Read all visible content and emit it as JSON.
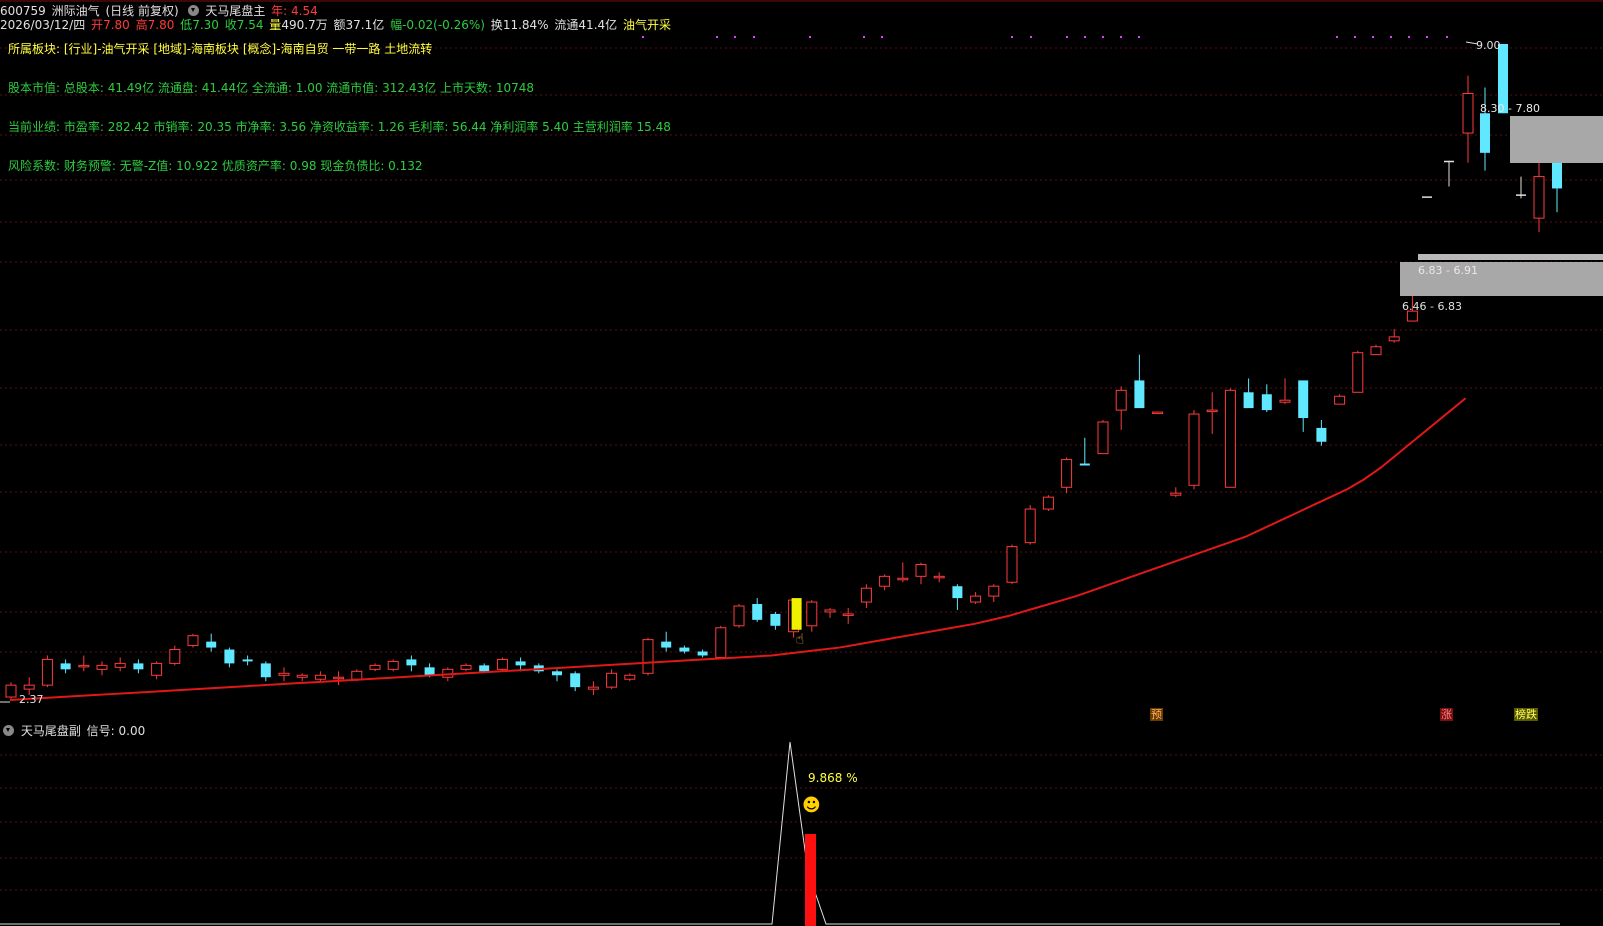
{
  "header": {
    "code": "600759",
    "name": "洲际油气",
    "period": "(日线 前复权)",
    "indicator": "天马尾盘主",
    "year_label": "年:",
    "year_value": "4.54"
  },
  "quote": {
    "date": "2026/03/12/四",
    "open_label": "开",
    "open": "7.80",
    "high_label": "高",
    "high": "7.80",
    "low_label": "低",
    "low": "7.30",
    "close_label": "收",
    "close": "7.54",
    "volume_label": "量",
    "volume": "490.7万",
    "amount_label": "额",
    "amount": "37.1亿",
    "change_label": "幅",
    "change": "-0.02(-0.26%)",
    "turnover_label": "换",
    "turnover": "11.84%",
    "float_label": "流通",
    "float": "41.4亿",
    "industry": "油气开采"
  },
  "info_lines": [
    "所属板块: [行业]-油气开采 [地域]-海南板块 [概念]-海南自贸 一带一路 土地流转",
    "股本市值: 总股本: 41.49亿 流通盘: 41.44亿 全流通: 1.00 流通市值: 312.43亿 上市天数: 10748",
    "当前业绩: 市盈率: 282.42 市销率: 20.35 市净率: 3.56 净资收益率: 1.26 毛利率: 56.44 净利润率 5.40 主营利润率 15.48",
    "风险系数: 财务预警: 无警-Z值: 10.922 优质资产率: 0.98 现金负债比: 0.132"
  ],
  "price_marks": {
    "high": "9.00",
    "low": "2.37",
    "zone_upper": "8.30 - 7.80",
    "zone_lower": "6.83 - 6.91",
    "zone_third": "6.46 - 6.83"
  },
  "tags": {
    "yu": "预",
    "zhang": "涨",
    "dieting": "榜跌"
  },
  "sub_panel": {
    "title": "天马尾盘副",
    "signal_label": "信号:",
    "signal_value": "0.00",
    "peak_value": "9.868",
    "peak_unit": "%",
    "smiley": "☻"
  },
  "colors": {
    "up": "#ff3b3b",
    "down": "#5fe8ff",
    "ma": "#e01818",
    "highlight": "#f0f000",
    "grid": "#5a1010"
  },
  "chart_data": {
    "type": "candlestick",
    "ylim": [
      2.37,
      9.0
    ],
    "candles": [
      {
        "o": 2.4,
        "h": 2.55,
        "l": 2.37,
        "c": 2.52
      },
      {
        "o": 2.48,
        "h": 2.6,
        "l": 2.42,
        "c": 2.52
      },
      {
        "o": 2.52,
        "h": 2.82,
        "l": 2.5,
        "c": 2.78
      },
      {
        "o": 2.74,
        "h": 2.78,
        "l": 2.64,
        "c": 2.68
      },
      {
        "o": 2.72,
        "h": 2.82,
        "l": 2.66,
        "c": 2.72
      },
      {
        "o": 2.68,
        "h": 2.76,
        "l": 2.62,
        "c": 2.72
      },
      {
        "o": 2.7,
        "h": 2.8,
        "l": 2.66,
        "c": 2.74
      },
      {
        "o": 2.74,
        "h": 2.78,
        "l": 2.64,
        "c": 2.68
      },
      {
        "o": 2.62,
        "h": 2.76,
        "l": 2.58,
        "c": 2.74
      },
      {
        "o": 2.74,
        "h": 2.92,
        "l": 2.72,
        "c": 2.88
      },
      {
        "o": 2.92,
        "h": 3.04,
        "l": 2.9,
        "c": 3.02
      },
      {
        "o": 2.96,
        "h": 3.04,
        "l": 2.86,
        "c": 2.9
      },
      {
        "o": 2.88,
        "h": 2.9,
        "l": 2.7,
        "c": 2.74
      },
      {
        "o": 2.78,
        "h": 2.82,
        "l": 2.72,
        "c": 2.76
      },
      {
        "o": 2.74,
        "h": 2.76,
        "l": 2.56,
        "c": 2.6
      },
      {
        "o": 2.62,
        "h": 2.7,
        "l": 2.56,
        "c": 2.64
      },
      {
        "o": 2.6,
        "h": 2.64,
        "l": 2.56,
        "c": 2.62
      },
      {
        "o": 2.58,
        "h": 2.66,
        "l": 2.56,
        "c": 2.62
      },
      {
        "o": 2.6,
        "h": 2.66,
        "l": 2.52,
        "c": 2.6
      },
      {
        "o": 2.58,
        "h": 2.68,
        "l": 2.56,
        "c": 2.66
      },
      {
        "o": 2.68,
        "h": 2.74,
        "l": 2.66,
        "c": 2.72
      },
      {
        "o": 2.68,
        "h": 2.78,
        "l": 2.66,
        "c": 2.76
      },
      {
        "o": 2.78,
        "h": 2.82,
        "l": 2.66,
        "c": 2.72
      },
      {
        "o": 2.7,
        "h": 2.74,
        "l": 2.6,
        "c": 2.62
      },
      {
        "o": 2.6,
        "h": 2.7,
        "l": 2.56,
        "c": 2.68
      },
      {
        "o": 2.68,
        "h": 2.74,
        "l": 2.66,
        "c": 2.72
      },
      {
        "o": 2.72,
        "h": 2.74,
        "l": 2.64,
        "c": 2.66
      },
      {
        "o": 2.68,
        "h": 2.8,
        "l": 2.66,
        "c": 2.78
      },
      {
        "o": 2.76,
        "h": 2.8,
        "l": 2.66,
        "c": 2.72
      },
      {
        "o": 2.72,
        "h": 2.74,
        "l": 2.64,
        "c": 2.66
      },
      {
        "o": 2.66,
        "h": 2.68,
        "l": 2.56,
        "c": 2.62
      },
      {
        "o": 2.64,
        "h": 2.66,
        "l": 2.46,
        "c": 2.5
      },
      {
        "o": 2.48,
        "h": 2.56,
        "l": 2.42,
        "c": 2.5
      },
      {
        "o": 2.5,
        "h": 2.68,
        "l": 2.48,
        "c": 2.64
      },
      {
        "o": 2.58,
        "h": 2.64,
        "l": 2.56,
        "c": 2.62
      },
      {
        "o": 2.64,
        "h": 3.0,
        "l": 2.62,
        "c": 2.98
      },
      {
        "o": 2.96,
        "h": 3.06,
        "l": 2.86,
        "c": 2.9
      },
      {
        "o": 2.9,
        "h": 2.92,
        "l": 2.84,
        "c": 2.86
      },
      {
        "o": 2.86,
        "h": 2.88,
        "l": 2.8,
        "c": 2.82
      },
      {
        "o": 2.8,
        "h": 3.12,
        "l": 2.8,
        "c": 3.1
      },
      {
        "o": 3.12,
        "h": 3.34,
        "l": 3.1,
        "c": 3.32
      },
      {
        "o": 3.34,
        "h": 3.4,
        "l": 3.16,
        "c": 3.18
      },
      {
        "o": 3.24,
        "h": 3.26,
        "l": 3.08,
        "c": 3.12
      },
      {
        "o": 3.06,
        "h": 3.4,
        "l": 3.0,
        "c": 3.38
      },
      {
        "o": 3.12,
        "h": 3.38,
        "l": 3.06,
        "c": 3.36
      },
      {
        "o": 3.26,
        "h": 3.3,
        "l": 3.2,
        "c": 3.28
      },
      {
        "o": 3.24,
        "h": 3.3,
        "l": 3.14,
        "c": 3.24
      },
      {
        "o": 3.36,
        "h": 3.54,
        "l": 3.3,
        "c": 3.5
      },
      {
        "o": 3.52,
        "h": 3.64,
        "l": 3.48,
        "c": 3.62
      },
      {
        "o": 3.6,
        "h": 3.76,
        "l": 3.56,
        "c": 3.6
      },
      {
        "o": 3.62,
        "h": 3.76,
        "l": 3.54,
        "c": 3.74
      },
      {
        "o": 3.62,
        "h": 3.66,
        "l": 3.56,
        "c": 3.62
      },
      {
        "o": 3.52,
        "h": 3.54,
        "l": 3.28,
        "c": 3.4
      },
      {
        "o": 3.36,
        "h": 3.46,
        "l": 3.34,
        "c": 3.42
      },
      {
        "o": 3.42,
        "h": 3.54,
        "l": 3.36,
        "c": 3.52
      },
      {
        "o": 3.56,
        "h": 3.94,
        "l": 3.54,
        "c": 3.92
      },
      {
        "o": 3.96,
        "h": 4.34,
        "l": 3.94,
        "c": 4.3
      },
      {
        "o": 4.3,
        "h": 4.44,
        "l": 4.28,
        "c": 4.42
      },
      {
        "o": 4.52,
        "h": 4.82,
        "l": 4.46,
        "c": 4.8
      },
      {
        "o": 4.76,
        "h": 5.02,
        "l": 4.74,
        "c": 4.74
      },
      {
        "o": 4.86,
        "h": 5.2,
        "l": 4.86,
        "c": 5.18
      },
      {
        "o": 5.3,
        "h": 5.54,
        "l": 5.1,
        "c": 5.5
      },
      {
        "o": 5.6,
        "h": 5.86,
        "l": 5.48,
        "c": 5.32
      },
      {
        "o": 5.28,
        "h": 5.28,
        "l": 5.28,
        "c": 5.28
      },
      {
        "o": 4.44,
        "h": 4.52,
        "l": 4.42,
        "c": 4.46
      },
      {
        "o": 4.54,
        "h": 5.3,
        "l": 4.5,
        "c": 5.26
      },
      {
        "o": 5.3,
        "h": 5.48,
        "l": 5.06,
        "c": 5.3
      },
      {
        "o": 4.52,
        "h": 5.52,
        "l": 4.52,
        "c": 5.5
      },
      {
        "o": 5.48,
        "h": 5.62,
        "l": 5.44,
        "c": 5.32
      },
      {
        "o": 5.46,
        "h": 5.56,
        "l": 5.28,
        "c": 5.3
      },
      {
        "o": 5.38,
        "h": 5.62,
        "l": 5.36,
        "c": 5.4
      },
      {
        "o": 5.6,
        "h": 5.6,
        "l": 5.08,
        "c": 5.22
      },
      {
        "o": 5.12,
        "h": 5.2,
        "l": 4.94,
        "c": 4.98
      },
      {
        "o": 5.36,
        "h": 5.46,
        "l": 5.36,
        "c": 5.44
      },
      {
        "o": 5.48,
        "h": 5.9,
        "l": 5.48,
        "c": 5.88
      },
      {
        "o": 5.86,
        "h": 5.96,
        "l": 5.86,
        "c": 5.94
      },
      {
        "o": 6.0,
        "h": 6.12,
        "l": 5.98,
        "c": 6.04
      },
      {
        "o": 6.2,
        "h": 6.46,
        "l": 6.2,
        "c": 6.3
      }
    ],
    "late_candles": [
      {
        "o": 7.46,
        "h": 7.46,
        "l": 7.46,
        "c": 7.46
      },
      {
        "o": 7.82,
        "h": 7.82,
        "l": 7.56,
        "c": 7.82
      },
      {
        "o": 8.1,
        "h": 8.68,
        "l": 7.8,
        "c": 8.5
      },
      {
        "o": 8.3,
        "h": 8.56,
        "l": 7.72,
        "c": 7.9
      },
      {
        "o": 9.0,
        "h": 9.0,
        "l": 8.3,
        "c": 8.3
      },
      {
        "o": 7.48,
        "h": 7.66,
        "l": 7.44,
        "c": 7.48
      },
      {
        "o": 7.24,
        "h": 7.8,
        "l": 7.1,
        "c": 7.66
      },
      {
        "o": 7.8,
        "h": 7.96,
        "l": 7.3,
        "c": 7.54
      }
    ],
    "ma": [
      2.37,
      2.38,
      2.39,
      2.4,
      2.41,
      2.42,
      2.43,
      2.44,
      2.45,
      2.46,
      2.47,
      2.48,
      2.49,
      2.5,
      2.51,
      2.52,
      2.53,
      2.54,
      2.55,
      2.56,
      2.57,
      2.58,
      2.59,
      2.6,
      2.61,
      2.62,
      2.63,
      2.64,
      2.65,
      2.66,
      2.67,
      2.68,
      2.69,
      2.7,
      2.71,
      2.72,
      2.73,
      2.74,
      2.75,
      2.76,
      2.77,
      2.78,
      2.79,
      2.8,
      2.81,
      2.82,
      2.84,
      2.86,
      2.88,
      2.9,
      2.93,
      2.96,
      2.99,
      3.02,
      3.05,
      3.08,
      3.11,
      3.14,
      3.18,
      3.22,
      3.27,
      3.32,
      3.37,
      3.42,
      3.48,
      3.54,
      3.6,
      3.66,
      3.72,
      3.78,
      3.84,
      3.9,
      3.96,
      4.02,
      4.1,
      4.18,
      4.26,
      4.34,
      4.42,
      4.5,
      4.6,
      4.72,
      4.86,
      5.0,
      5.14,
      5.28,
      5.42
    ]
  }
}
